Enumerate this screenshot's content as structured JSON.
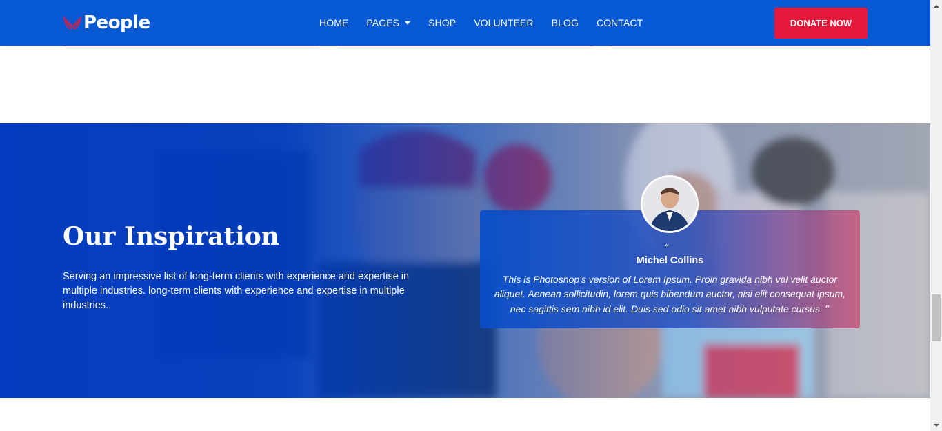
{
  "header": {
    "logo_text": "People",
    "nav": [
      {
        "label": "HOME"
      },
      {
        "label": "PAGES",
        "has_dropdown": true
      },
      {
        "label": "SHOP"
      },
      {
        "label": "VOLUNTEER"
      },
      {
        "label": "BLOG"
      },
      {
        "label": "CONTACT"
      }
    ],
    "donate_label": "DONATE NOW"
  },
  "inspiration": {
    "title": "Our Inspiration",
    "description": "Serving an impressive list of long-term clients with experience and expertise in multiple industries. long-term clients with experience and expertise in multiple industries..",
    "testimonial": {
      "quote_open_icon": "quote-open-icon",
      "name": "Michel Collins",
      "quote": "This is Photoshop's version of Lorem Ipsum. Proin gravida nibh vel velit auctor aliquet. Aenean sollicitudin, lorem quis bibendum auctor, nisi elit consequat ipsum, nec sagittis sem nibh id elit. Duis sed odio sit amet nibh vulputate cursus.",
      "quote_close_icon": "quote-close-icon"
    }
  },
  "colors": {
    "header_bg": "#0759d3",
    "donate_bg": "#e5193b",
    "section_blue": "#003cbe"
  }
}
